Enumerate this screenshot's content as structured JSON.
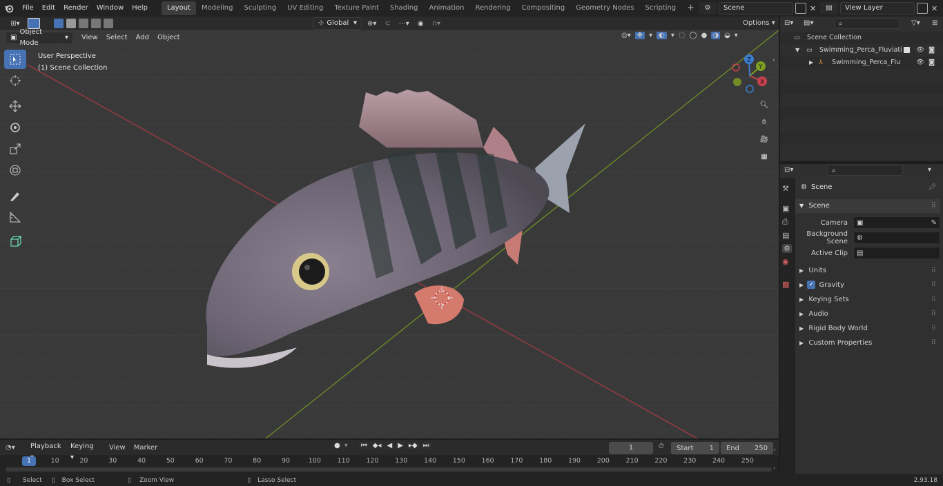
{
  "menu": {
    "items": [
      "File",
      "Edit",
      "Render",
      "Window",
      "Help"
    ]
  },
  "workspaces": {
    "tabs": [
      "Layout",
      "Modeling",
      "Sculpting",
      "UV Editing",
      "Texture Paint",
      "Shading",
      "Animation",
      "Rendering",
      "Compositing",
      "Geometry Nodes",
      "Scripting"
    ],
    "active": "Layout"
  },
  "scene": {
    "name": "Scene"
  },
  "view_layer": {
    "name": "View Layer"
  },
  "header": {
    "orientation": "Global",
    "options_label": "Options"
  },
  "viewport": {
    "mode": "Object Mode",
    "menus": [
      "View",
      "Select",
      "Add",
      "Object"
    ],
    "overlay_line1": "User Perspective",
    "overlay_line2": "(1) Scene Collection",
    "gizmo_axes": [
      "X",
      "Y",
      "Z"
    ]
  },
  "outliner": {
    "root": "Scene Collection",
    "collection": "Swimming_Perca_Fluviatilis_C",
    "object": "Swimming_Perca_Fluviat"
  },
  "properties": {
    "title": "Scene",
    "section": "Scene",
    "fields": [
      {
        "label": "Camera",
        "value": ""
      },
      {
        "label": "Background Scene",
        "value": ""
      },
      {
        "label": "Active Clip",
        "value": ""
      }
    ],
    "panels": [
      "Units",
      "Gravity",
      "Keying Sets",
      "Audio",
      "Rigid Body World",
      "Custom Properties"
    ],
    "gravity_checked": true
  },
  "timeline": {
    "menus": [
      "Playback",
      "Keying",
      "View",
      "Marker"
    ],
    "current_frame": "1",
    "start_label": "Start",
    "start_value": "1",
    "end_label": "End",
    "end_value": "250",
    "ticks": [
      "1",
      "10",
      "20",
      "30",
      "40",
      "50",
      "60",
      "70",
      "80",
      "90",
      "100",
      "110",
      "120",
      "130",
      "140",
      "150",
      "160",
      "170",
      "180",
      "190",
      "200",
      "210",
      "220",
      "230",
      "240",
      "250"
    ]
  },
  "statusbar": {
    "select": "Select",
    "box_select": "Box Select",
    "zoom_view": "Zoom View",
    "lasso_select": "Lasso Select",
    "version": "2.93.18"
  },
  "colors": {
    "accent": "#4772b3",
    "x_axis": "#c8414e",
    "y_axis": "#7fa023",
    "z_axis": "#3c7dd0"
  }
}
